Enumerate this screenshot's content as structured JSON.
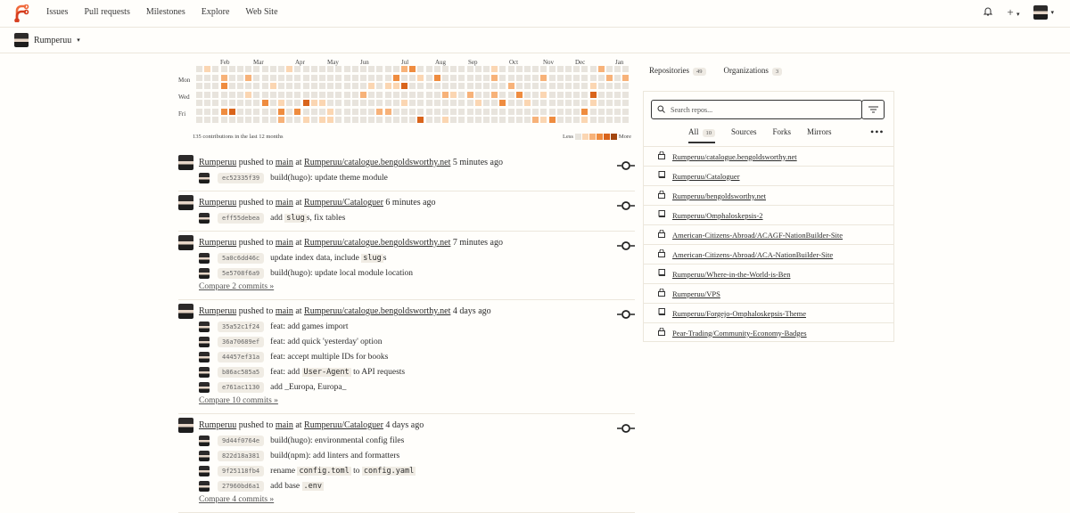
{
  "nav": {
    "links": [
      "Issues",
      "Pull requests",
      "Milestones",
      "Explore",
      "Web Site"
    ]
  },
  "context": {
    "user": "Rumperuu"
  },
  "heatmap": {
    "months": [
      "Feb",
      "Mar",
      "Apr",
      "May",
      "Jun",
      "Jul",
      "Aug",
      "Sep",
      "Oct",
      "Nov",
      "Dec",
      "Jan"
    ],
    "days": [
      "Mon",
      "Wed",
      "Fri"
    ],
    "summary": "135 contributions in the last 12 months",
    "legend_less": "Less",
    "legend_more": "More",
    "colors": [
      "#e8e4dd",
      "#fbd6b2",
      "#f7b279",
      "#ef8c3f",
      "#d9641b",
      "#a3460e"
    ]
  },
  "feed": [
    {
      "user": "Rumperuu",
      "action": "pushed to",
      "branch": "main",
      "at": "at",
      "repo": "Rumperuu/catalogue.bengoldsworthy.net",
      "time": "5 minutes ago",
      "commits": [
        {
          "sha": "ec52335f39",
          "parts": [
            {
              "t": "build(hugo): update theme module"
            }
          ]
        }
      ],
      "compare": ""
    },
    {
      "user": "Rumperuu",
      "action": "pushed to",
      "branch": "main",
      "at": "at",
      "repo": "Rumperuu/Cataloguer",
      "time": "6 minutes ago",
      "commits": [
        {
          "sha": "eff55debea",
          "parts": [
            {
              "t": "add "
            },
            {
              "c": "slug"
            },
            {
              "t": "s, fix tables"
            }
          ]
        }
      ],
      "compare": ""
    },
    {
      "user": "Rumperuu",
      "action": "pushed to",
      "branch": "main",
      "at": "at",
      "repo": "Rumperuu/catalogue.bengoldsworthy.net",
      "time": "7 minutes ago",
      "commits": [
        {
          "sha": "5a0c6dd46c",
          "parts": [
            {
              "t": "update index data, include "
            },
            {
              "c": "slug"
            },
            {
              "t": "s"
            }
          ]
        },
        {
          "sha": "5e5708f6a9",
          "parts": [
            {
              "t": "build(hugo): update local module location"
            }
          ]
        }
      ],
      "compare": "Compare 2 commits »"
    },
    {
      "user": "Rumperuu",
      "action": "pushed to",
      "branch": "main",
      "at": "at",
      "repo": "Rumperuu/catalogue.bengoldsworthy.net",
      "time": "4 days ago",
      "commits": [
        {
          "sha": "35a52c1f24",
          "parts": [
            {
              "t": "feat: add games import"
            }
          ]
        },
        {
          "sha": "36a70689ef",
          "parts": [
            {
              "t": "feat: add quick 'yesterday' option"
            }
          ]
        },
        {
          "sha": "44457ef31a",
          "parts": [
            {
              "t": "feat: accept multiple IDs for books"
            }
          ]
        },
        {
          "sha": "b86ac585a5",
          "parts": [
            {
              "t": "feat: add "
            },
            {
              "c": "User-Agent"
            },
            {
              "t": " to API requests"
            }
          ]
        },
        {
          "sha": "e761ac1130",
          "parts": [
            {
              "t": "add _Europa, Europa_"
            }
          ]
        }
      ],
      "compare": "Compare 10 commits »"
    },
    {
      "user": "Rumperuu",
      "action": "pushed to",
      "branch": "main",
      "at": "at",
      "repo": "Rumperuu/Cataloguer",
      "time": "4 days ago",
      "commits": [
        {
          "sha": "9d44f0764e",
          "parts": [
            {
              "t": "build(hugo): environmental config files"
            }
          ]
        },
        {
          "sha": "822d18a381",
          "parts": [
            {
              "t": "build(npm): add linters and formatters"
            }
          ]
        },
        {
          "sha": "9f25118fb4",
          "parts": [
            {
              "t": "rename "
            },
            {
              "c": "config.toml"
            },
            {
              "t": " to "
            },
            {
              "c": "config.yaml"
            }
          ]
        },
        {
          "sha": "27960bd6a1",
          "parts": [
            {
              "t": "add base "
            },
            {
              "c": ".env"
            }
          ]
        }
      ],
      "compare": "Compare 4 commits »"
    }
  ],
  "right": {
    "tabs": [
      {
        "label": "Repositories",
        "count": "49"
      },
      {
        "label": "Organizations",
        "count": "3"
      }
    ],
    "search_placeholder": "Search repos...",
    "subtabs": [
      {
        "label": "All",
        "count": "10"
      },
      {
        "label": "Sources"
      },
      {
        "label": "Forks"
      },
      {
        "label": "Mirrors"
      }
    ],
    "more": "•••",
    "repos": [
      {
        "name": "Rumperuu/catalogue.bengoldsworthy.net",
        "icon": "lock-icon"
      },
      {
        "name": "Rumperuu/Cataloguer",
        "icon": "repo-icon"
      },
      {
        "name": "Rumperuu/bengoldsworthy.net",
        "icon": "lock-icon"
      },
      {
        "name": "Rumperuu/Omphaloskepsis-2",
        "icon": "repo-icon"
      },
      {
        "name": "American-Citizens-Abroad/ACAGF-NationBuilder-Site",
        "icon": "lock-icon"
      },
      {
        "name": "American-Citizens-Abroad/ACA-NationBuilder-Site",
        "icon": "lock-icon"
      },
      {
        "name": "Rumperuu/Where-in-the-World-is-Ben",
        "icon": "repo-icon"
      },
      {
        "name": "Rumperuu/VPS",
        "icon": "lock-icon"
      },
      {
        "name": "Rumperuu/Forgejo-Omphaloskepsis-Theme",
        "icon": "repo-icon"
      },
      {
        "name": "Pear-Trading/Community-Economy-Badges",
        "icon": "lock-icon"
      }
    ]
  }
}
